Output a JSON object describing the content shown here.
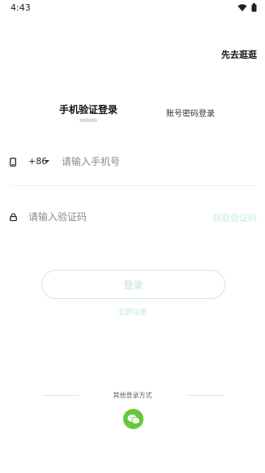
{
  "status_bar": {
    "time": "4:43"
  },
  "header": {
    "skip_label": "先去逛逛"
  },
  "tabs": [
    {
      "label": "手机验证登录",
      "active": true
    },
    {
      "label": "账号密码登录",
      "active": false
    }
  ],
  "phone_row": {
    "country_code": "+86",
    "placeholder": "请输入手机号",
    "value": ""
  },
  "code_row": {
    "placeholder": "请输入验证码",
    "value": "",
    "get_code_label": "获取验证码"
  },
  "login_button_label": "登录",
  "register_label": "立即注册",
  "other_login": {
    "label": "其他登录方式",
    "wechat_icon": "wechat-icon"
  },
  "colors": {
    "accent_light": "#c5ecd9",
    "wechat_green": "#66c93a"
  }
}
